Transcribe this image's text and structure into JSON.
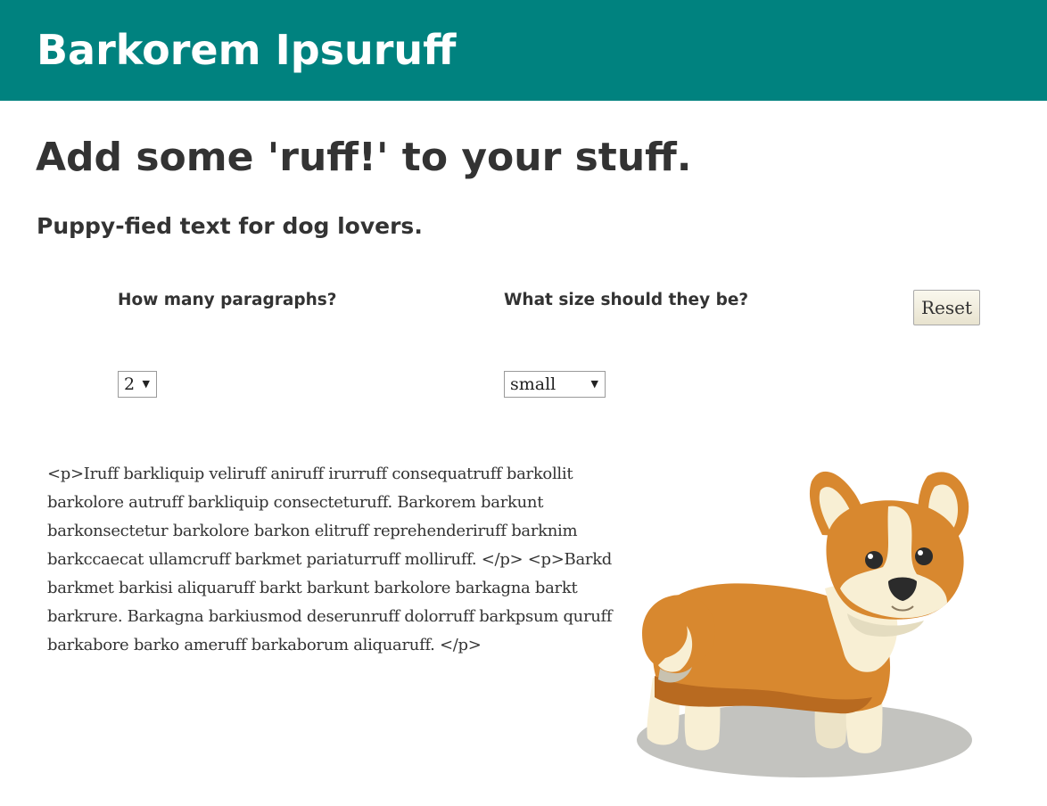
{
  "header": {
    "site_title": "Barkorem Ipsuruff",
    "background_color": "#00827f"
  },
  "main": {
    "headline": "Add some 'ruff!' to your stuff.",
    "subheadline": "Puppy-fied text for dog lovers."
  },
  "controls": {
    "paragraphs_label": "How many paragraphs?",
    "paragraphs_value": "2",
    "size_label": "What size should they be?",
    "size_value": "small",
    "reset_label": "Reset",
    "select_arrow": "▼"
  },
  "output": {
    "text": "<p>Iruff barkliquip veliruff aniruff irurruff consequatruff barkollit barkolore autruff barkliquip consecteturuff. Barkorem barkunt barkonsectetur barkolore barkon elitruff reprehenderiruff barknim barkccaecat ullamcruff barkmet pariaturruff molliruff. </p> <p>Barkd barkmet barkisi aliquaruff barkt barkunt barkolore barkagna barkt barkrure. Barkagna barkiusmod deserunruff dolorruff barkpsum quruff barkabore barko ameruff barkaborum aliquaruff. </p>"
  },
  "illustration": {
    "icon": "corgi-illustration",
    "colors": {
      "fur": "#d8882f",
      "fur_dark": "#b86a20",
      "cream": "#f8efd4",
      "shadow": "#b8b8b4"
    }
  }
}
